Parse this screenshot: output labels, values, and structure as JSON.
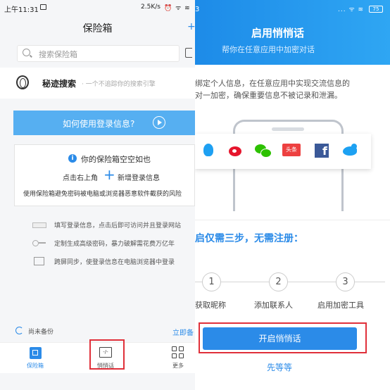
{
  "left": {
    "status": {
      "time": "上午11:31",
      "speed": "2.5K/s",
      "signal": "⏰ ᯤ ≋"
    },
    "nav": {
      "title": "保险箱",
      "plus": "+"
    },
    "search": {
      "placeholder": "搜索保险箱"
    },
    "mijiso": {
      "name": "秘迹搜索",
      "slogan": "· 一个不追踪你的搜索引擎"
    },
    "how_button": {
      "label": "如何使用登录信息?"
    },
    "empty_card": {
      "title": "你的保险箱空空如也",
      "hint_left": "点击右上角",
      "hint_right": "新增登录信息",
      "note": "使用保险箱避免密码被电脑或浏览器恶意软件截获的风险"
    },
    "features": [
      {
        "label": "填写登录信息，点击后即可访问并且登录网站",
        "icon": "card-icon"
      },
      {
        "label": "定制生成高级密码，暴力破解需花费万亿年",
        "icon": "key-icon"
      },
      {
        "label": "跨屏同步，使登录信息在电脑浏览器中登录",
        "icon": "sync-screen-icon"
      }
    ],
    "backup": {
      "status": "尚未备份",
      "action": "立即备"
    },
    "tabs": [
      {
        "label": "保险箱",
        "icon": "safe-icon",
        "active": true
      },
      {
        "label": "悄悄话",
        "icon": "whisper-icon",
        "icon_text": "-/-"
      },
      {
        "label": "更多",
        "icon": "grid-icon"
      }
    ]
  },
  "right": {
    "status": {
      "time": "3",
      "signal": "... ᯤ ≋",
      "battery": "75"
    },
    "header": {
      "title": "启用悄悄话",
      "subtitle": "帮你在任意应用中加密对话"
    },
    "description": [
      "绑定个人信息，在任意应用中实现交流信息的",
      "对一加密，确保重要信息不被记录和泄漏。"
    ],
    "apps": [
      {
        "name": "qq-icon"
      },
      {
        "name": "weibo-icon"
      },
      {
        "name": "wechat-icon"
      },
      {
        "name": "toutiao-icon",
        "label": "头条"
      },
      {
        "name": "facebook-icon",
        "label": "f"
      },
      {
        "name": "twitter-icon"
      }
    ],
    "steps_title": "启仅需三步，无需注册：",
    "steps": [
      {
        "num": "1",
        "label": "获取昵称"
      },
      {
        "num": "2",
        "label": "添加联系人"
      },
      {
        "num": "3",
        "label": "启用加密工具"
      }
    ],
    "open_button": "开启悄悄话",
    "later_link": "先等等"
  },
  "colors": {
    "accent": "#2b8be8",
    "highlight": "#e0303a"
  }
}
